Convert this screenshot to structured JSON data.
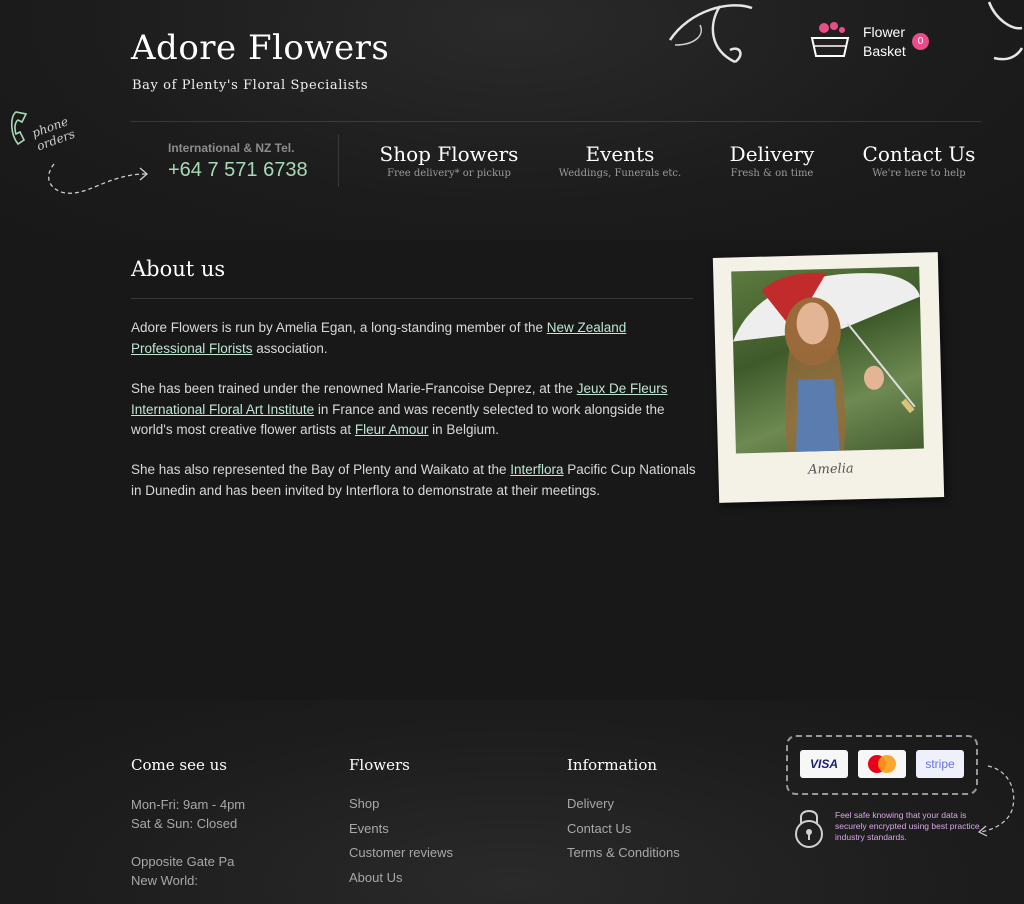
{
  "header": {
    "site_title": "Adore Flowers",
    "tagline": "Bay of Plenty's Floral Specialists",
    "basket_label_line1": "Flower",
    "basket_label_line2": "Basket",
    "basket_count": "0",
    "phone_doodle": "phone orders",
    "phone_label": "International & NZ Tel.",
    "phone_number": "+64 7 571 6738"
  },
  "nav": [
    {
      "title": "Shop Flowers",
      "sub": "Free delivery* or pickup"
    },
    {
      "title": "Events",
      "sub": "Weddings, Funerals etc."
    },
    {
      "title": "Delivery",
      "sub": "Fresh & on time"
    },
    {
      "title": "Contact Us",
      "sub": "We're here to help"
    }
  ],
  "content": {
    "heading": "About us",
    "p1": {
      "t1": "Adore Flowers is run by Amelia Egan, a long-standing member of the ",
      "link": "New Zealand Professional Florists",
      "t2": " association."
    },
    "p2": {
      "t1": "She has been trained under the renowned Marie-Francoise Deprez, at the ",
      "link1": "Jeux De Fleurs International Floral Art Institute",
      "t2": " in France and was recently selected to work alongside the world's most creative flower artists at ",
      "link2": "Fleur Amour",
      "t3": " in Belgium."
    },
    "p3": {
      "t1": "She has also represented the Bay of Plenty and Waikato at the ",
      "link": "Interflora",
      "t2": " Pacific Cup Nationals in Dunedin and has been invited by Interflora to demonstrate at their meetings."
    },
    "photo_caption": "Amelia"
  },
  "footer": {
    "col1": {
      "heading": "Come see us",
      "hours1": "Mon-Fri: 9am - 4pm",
      "hours2": "Sat & Sun: Closed",
      "loc1": "Opposite Gate Pa",
      "loc2": "New World:"
    },
    "col2": {
      "heading": "Flowers",
      "links": [
        "Shop",
        "Events",
        "Customer reviews",
        "About Us"
      ]
    },
    "col3": {
      "heading": "Information",
      "links": [
        "Delivery",
        "Contact Us",
        "Terms & Conditions"
      ]
    },
    "payments": {
      "cards": [
        "VISA",
        "MasterCard",
        "stripe"
      ],
      "secure_text": "Feel safe knowing that your data is securely encrypted using best practice industry standards."
    }
  },
  "colors": {
    "background": "#181818",
    "link": "#bfe6d2",
    "phone": "#a9d9b8",
    "badge": "#e84d8a",
    "secure_text": "#d7a8e6"
  }
}
